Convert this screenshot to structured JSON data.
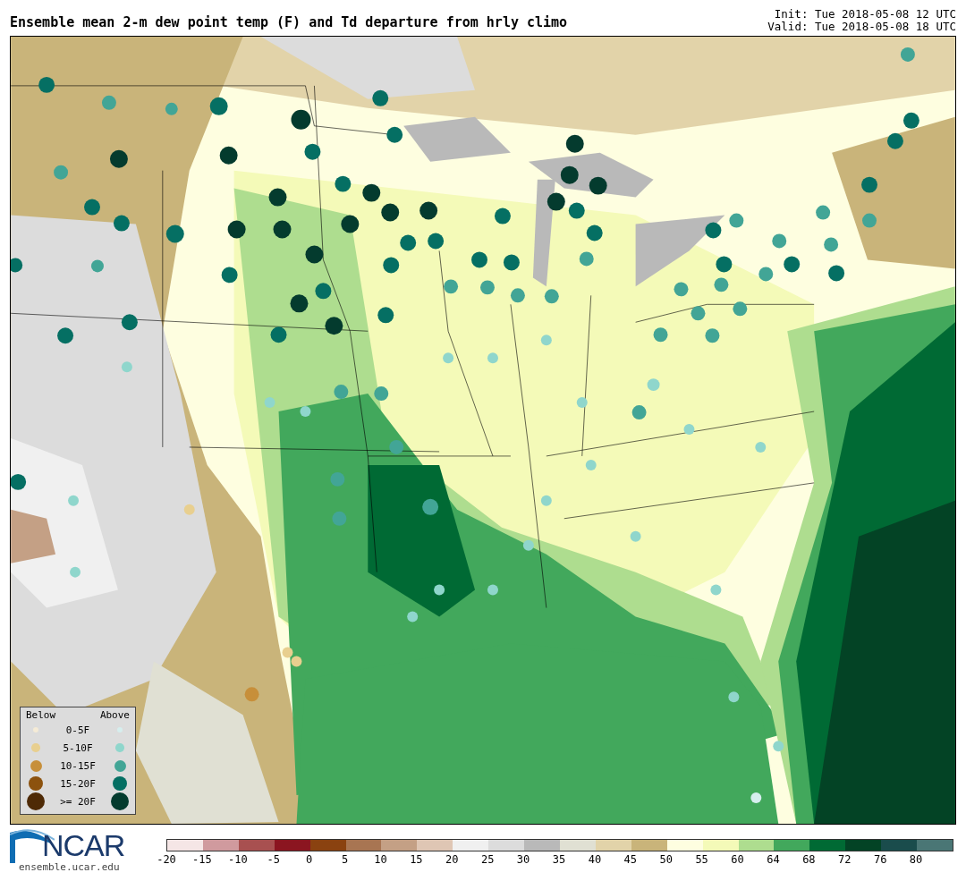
{
  "header": {
    "title": "Ensemble mean 2-m dew point temp (F) and Td departure from hrly climo",
    "init": "Init: Tue 2018-05-08 12 UTC",
    "valid": "Valid: Tue 2018-05-08 18 UTC"
  },
  "legend": {
    "below_label": "Below",
    "above_label": "Above",
    "rows": [
      {
        "label": "0-5F",
        "below": {
          "color": "#f5ebd6"
        },
        "above": {
          "color": "#d6eeee"
        }
      },
      {
        "label": "5-10F",
        "below": {
          "color": "#e8cf8f"
        },
        "above": {
          "color": "#8fd6cc"
        }
      },
      {
        "label": "10-15F",
        "below": {
          "color": "#c78f3a"
        },
        "above": {
          "color": "#42a596"
        }
      },
      {
        "label": "15-20F",
        "below": {
          "color": "#8c520e"
        },
        "above": {
          "color": "#056f63"
        }
      },
      {
        "label": ">= 20F",
        "below": {
          "color": "#4e2a06"
        },
        "above": {
          "color": "#043b2e"
        }
      }
    ]
  },
  "logo": {
    "name": "NCAR",
    "url": "ensemble.ucar.edu"
  },
  "colorbar": {
    "segments": [
      {
        "color": "#f5e6e6"
      },
      {
        "color": "#d09a9e"
      },
      {
        "color": "#a85050"
      },
      {
        "color": "#8b1520"
      },
      {
        "color": "#8a4210"
      },
      {
        "color": "#a87552"
      },
      {
        "color": "#c4a085"
      },
      {
        "color": "#dfc6b4"
      },
      {
        "color": "#f0f0f0"
      },
      {
        "color": "#dcdcdc"
      },
      {
        "color": "#b9b9b9"
      },
      {
        "color": "#e0e0d3"
      },
      {
        "color": "#e2d3a9"
      },
      {
        "color": "#c9b47a"
      },
      {
        "color": "#fefee0"
      },
      {
        "color": "#f4fab8"
      },
      {
        "color": "#aedd8f"
      },
      {
        "color": "#42a85c"
      },
      {
        "color": "#006a34"
      },
      {
        "color": "#034325"
      },
      {
        "color": "#1a4c4c"
      },
      {
        "color": "#4a7675"
      }
    ],
    "ticks": [
      "-20",
      "-15",
      "-10",
      "-5",
      "0",
      "5",
      "10",
      "15",
      "20",
      "25",
      "30",
      "35",
      "40",
      "45",
      "50",
      "55",
      "60",
      "64",
      "68",
      "72",
      "76",
      "80"
    ]
  }
}
